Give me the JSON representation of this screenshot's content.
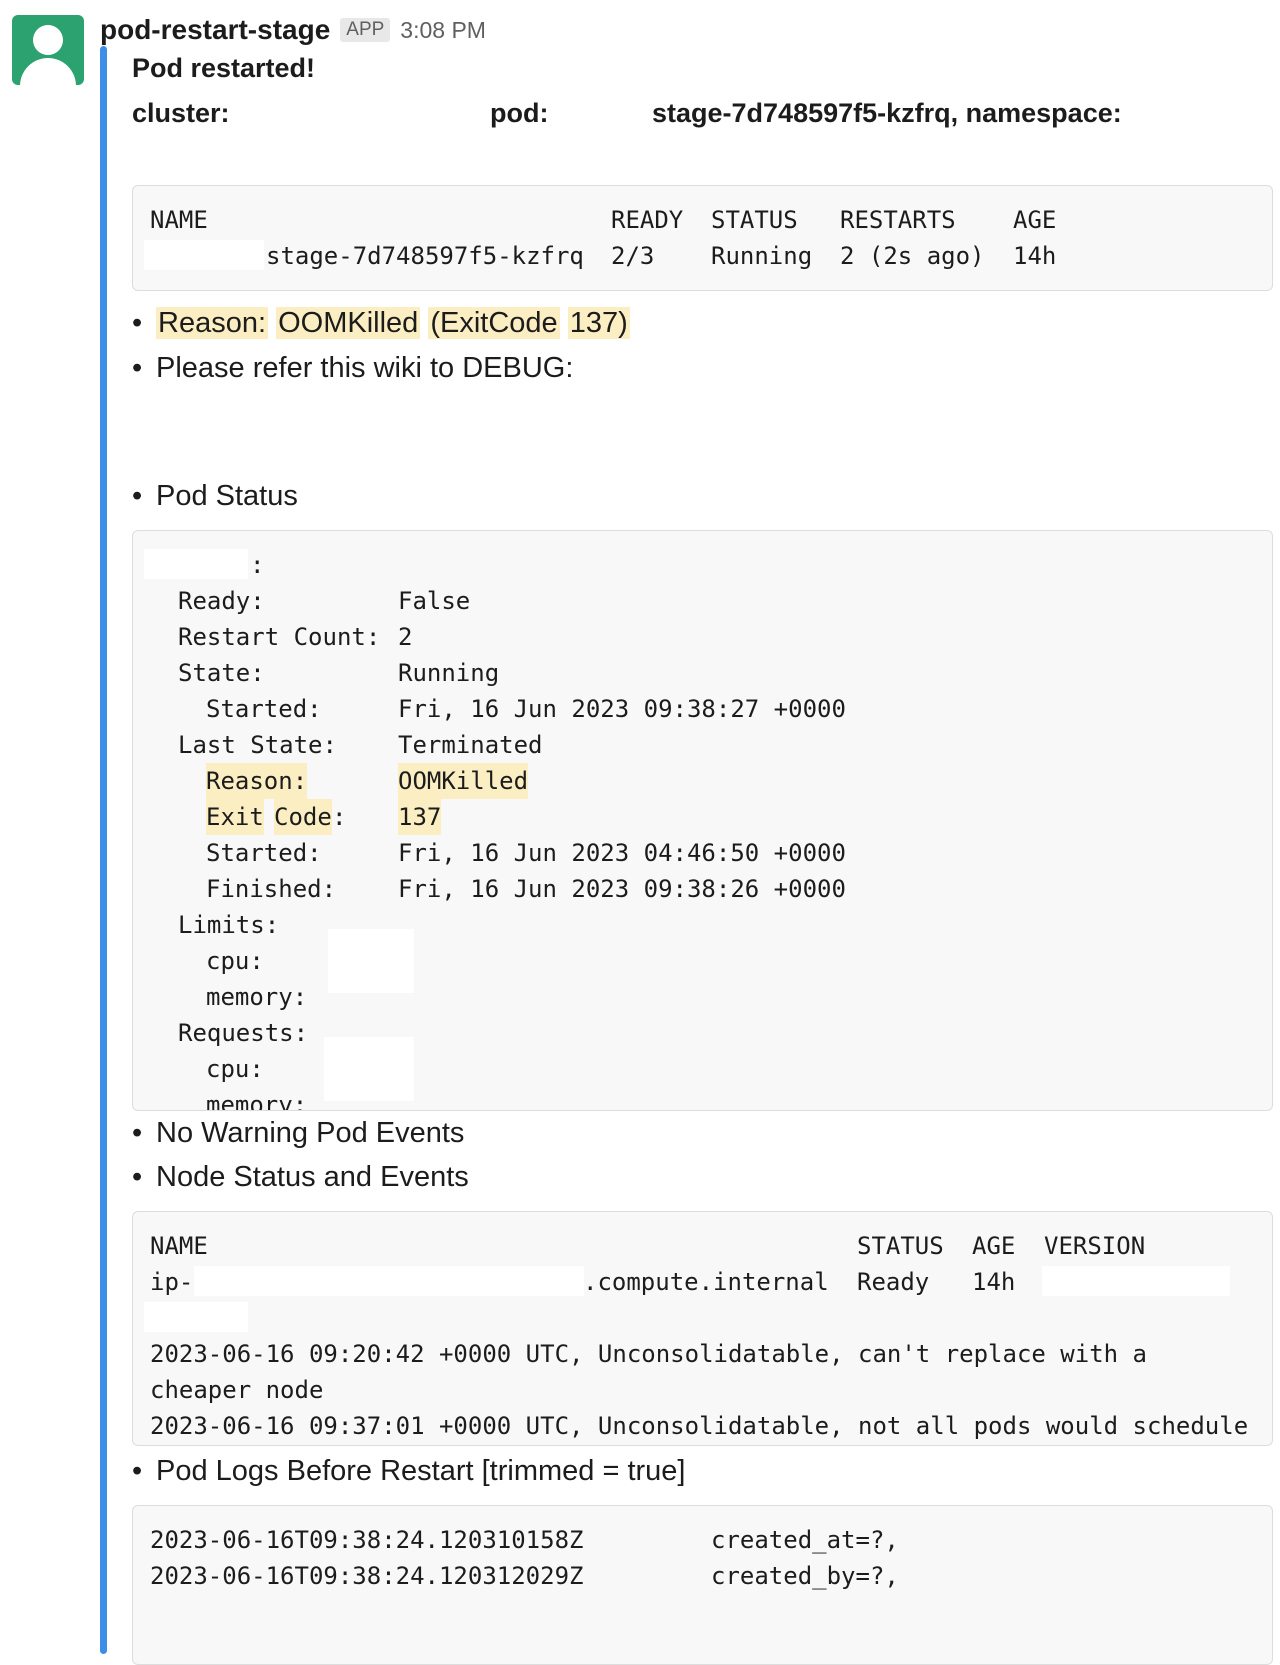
{
  "header": {
    "sender": "pod-restart-stage",
    "badge": "APP",
    "time": "3:08 PM"
  },
  "message": {
    "title": "Pod restarted!",
    "cluster_label": "cluster:",
    "pod_label": "pod:",
    "pod_value": "stage-7d748597f5-kzfrq, namespace:"
  },
  "pod_table": {
    "headers": [
      "NAME",
      "READY",
      "STATUS",
      "RESTARTS",
      "AGE"
    ],
    "row": [
      "stage-7d748597f5-kzfrq",
      "2/3",
      "Running",
      "2 (2s ago)",
      "14h"
    ]
  },
  "bullets": {
    "reason_words": [
      "Reason:",
      "OOMKilled",
      "(ExitCode",
      "137)"
    ],
    "wiki": "Please refer this wiki to DEBUG:",
    "pod_status": "Pod Status",
    "no_warning": "No Warning Pod Events",
    "node_status": "Node Status and Events",
    "pod_logs": "Pod Logs Before Restart [trimmed = true]"
  },
  "pod_status_block": {
    "container_suffix": ":",
    "rows": [
      {
        "label": "Ready:",
        "value": "False"
      },
      {
        "label": "Restart Count:",
        "value": "2"
      },
      {
        "label": "State:",
        "value": "Running"
      },
      {
        "label": "Started:",
        "value": "Fri, 16 Jun 2023 09:38:27 +0000"
      },
      {
        "label": "Last State:",
        "value": "Terminated"
      },
      {
        "label": "Reason:",
        "value": "OOMKilled"
      },
      {
        "label_a": "Exit",
        "label_b": "Code",
        "colon": ":",
        "value": "137"
      },
      {
        "label": "Started:",
        "value": "Fri, 16 Jun 2023 04:46:50 +0000"
      },
      {
        "label": "Finished:",
        "value": "Fri, 16 Jun 2023 09:38:26 +0000"
      },
      {
        "label": "Limits:"
      },
      {
        "label": "cpu:"
      },
      {
        "label": "memory:"
      },
      {
        "label": "Requests:"
      },
      {
        "label": "cpu:"
      },
      {
        "label": "memory:"
      }
    ]
  },
  "node_block": {
    "headers": [
      "NAME",
      "STATUS",
      "AGE",
      "VERSION"
    ],
    "name_prefix": "ip-",
    "name_suffix": ".compute.internal",
    "status": "Ready",
    "age": "14h",
    "events": [
      "2023-06-16 09:20:42 +0000 UTC, Unconsolidatable, can't replace with a",
      "cheaper node",
      "2023-06-16 09:37:01 +0000 UTC, Unconsolidatable, not all pods would schedule"
    ]
  },
  "logs_block": {
    "lines": [
      {
        "ts": "2023-06-16T09:38:24.120310158Z",
        "msg": "created_at=?,"
      },
      {
        "ts": "2023-06-16T09:38:24.120312029Z",
        "msg": "created_by=?,"
      }
    ]
  }
}
